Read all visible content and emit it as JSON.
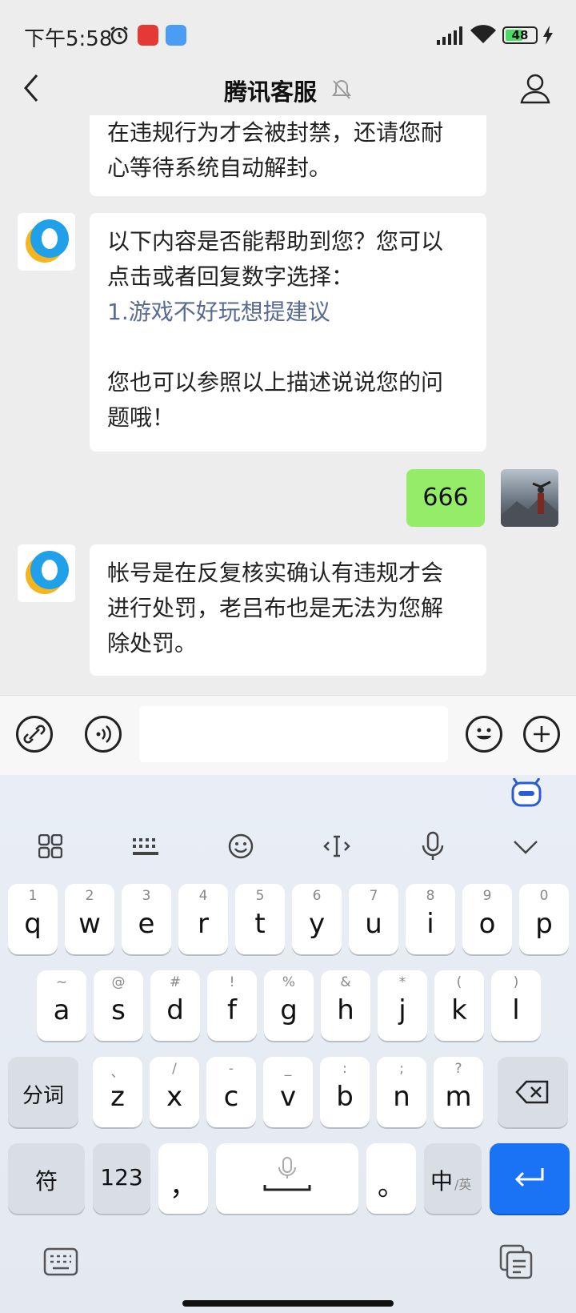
{
  "status_bar": {
    "time": "下午5:58",
    "battery": "48"
  },
  "nav": {
    "title": "腾讯客服"
  },
  "messages": [
    {
      "text_line1": "在违规行为才会被封禁，还请您耐",
      "text_line2": "心等待系统自动解封。"
    },
    {
      "line1": "以下内容是否能帮助到您？您可以",
      "line2": "点击或者回复数字选择：",
      "link": "1.游戏不好玩想提建议",
      "line3": "您也可以参照以上描述说说您的问",
      "line4": "题哦！"
    },
    {
      "text": "666"
    },
    {
      "line1": "帐号是在反复核实确认有违规才会",
      "line2": "进行处罚，老吕布也是无法为您解",
      "line3": "除处罚。"
    }
  ],
  "keyboard": {
    "row1": [
      {
        "k": "q",
        "s": "1"
      },
      {
        "k": "w",
        "s": "2"
      },
      {
        "k": "e",
        "s": "3"
      },
      {
        "k": "r",
        "s": "4"
      },
      {
        "k": "t",
        "s": "5"
      },
      {
        "k": "y",
        "s": "6"
      },
      {
        "k": "u",
        "s": "7"
      },
      {
        "k": "i",
        "s": "8"
      },
      {
        "k": "o",
        "s": "9"
      },
      {
        "k": "p",
        "s": "0"
      }
    ],
    "row2": [
      {
        "k": "a",
        "s": "~"
      },
      {
        "k": "s",
        "s": "@"
      },
      {
        "k": "d",
        "s": "#"
      },
      {
        "k": "f",
        "s": "!"
      },
      {
        "k": "g",
        "s": "%"
      },
      {
        "k": "h",
        "s": "&"
      },
      {
        "k": "j",
        "s": "*"
      },
      {
        "k": "k",
        "s": "("
      },
      {
        "k": "l",
        "s": ")"
      }
    ],
    "row3": [
      {
        "k": "z",
        "s": "、"
      },
      {
        "k": "x",
        "s": "/"
      },
      {
        "k": "c",
        "s": "-"
      },
      {
        "k": "v",
        "s": "_"
      },
      {
        "k": "b",
        "s": ":"
      },
      {
        "k": "n",
        "s": ";"
      },
      {
        "k": "m",
        "s": "?"
      }
    ],
    "fenci": "分词",
    "fu": "符",
    "num": "123",
    "comma": "，",
    "period": "。",
    "zhong": "中",
    "ying": "/英"
  }
}
